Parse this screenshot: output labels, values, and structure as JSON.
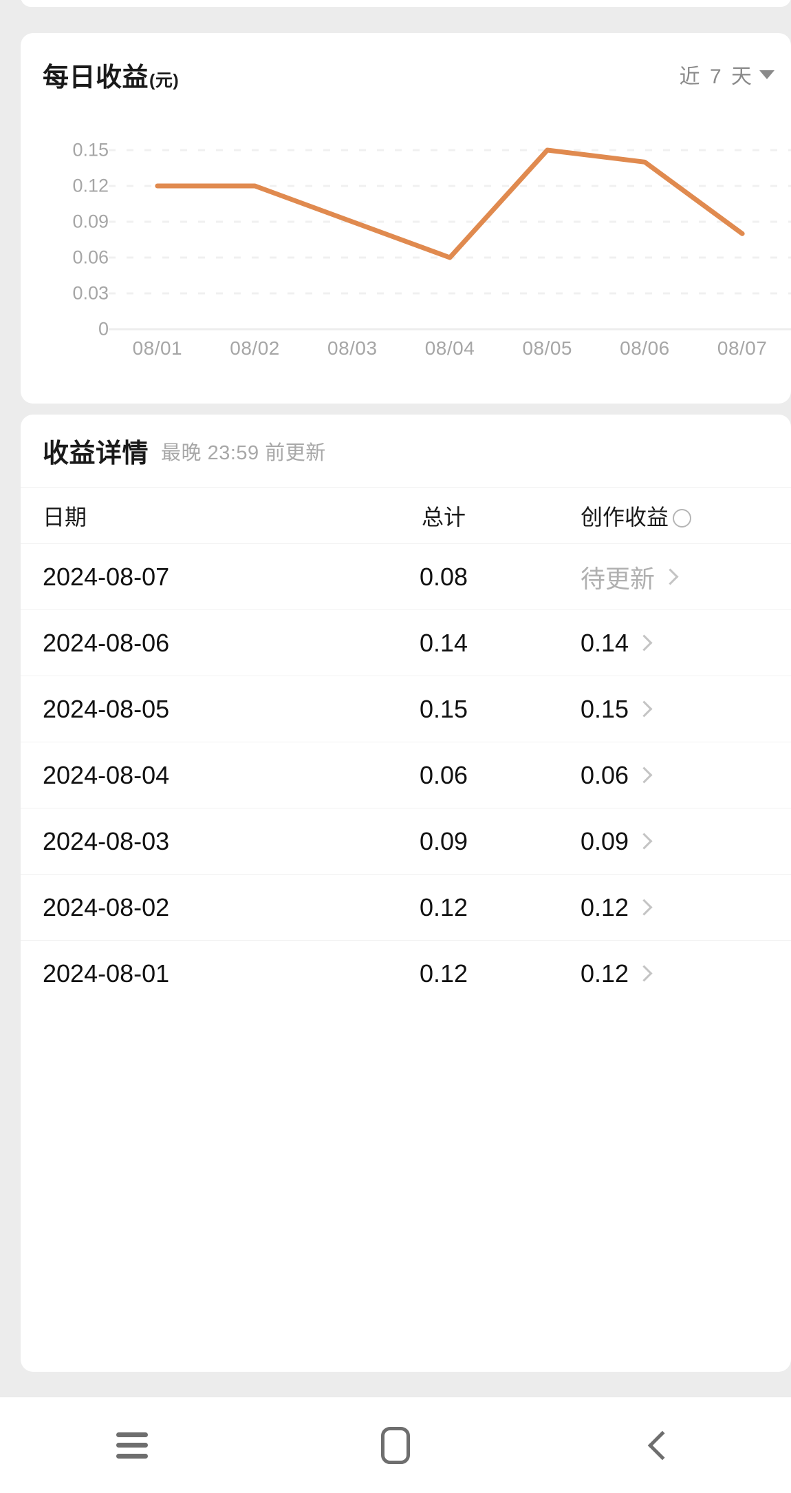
{
  "chart_card": {
    "title": "每日收益",
    "unit": "(元)",
    "range_label": "近 7 天",
    "caret_icon": "chevron-down-icon"
  },
  "detail_card": {
    "title": "收益详情",
    "subtitle": "最晚 23:59 前更新",
    "columns": {
      "date": "日期",
      "total": "总计",
      "creation": "创作收益"
    },
    "info_icon": "info-circle-icon",
    "rows": [
      {
        "date": "2024-08-07",
        "total": "0.08",
        "creation": "待更新",
        "pending": true
      },
      {
        "date": "2024-08-06",
        "total": "0.14",
        "creation": "0.14",
        "pending": false
      },
      {
        "date": "2024-08-05",
        "total": "0.15",
        "creation": "0.15",
        "pending": false
      },
      {
        "date": "2024-08-04",
        "total": "0.06",
        "creation": "0.06",
        "pending": false
      },
      {
        "date": "2024-08-03",
        "total": "0.09",
        "creation": "0.09",
        "pending": false
      },
      {
        "date": "2024-08-02",
        "total": "0.12",
        "creation": "0.12",
        "pending": false
      },
      {
        "date": "2024-08-01",
        "total": "0.12",
        "creation": "0.12",
        "pending": false
      }
    ]
  },
  "navbar": {
    "recents_icon": "recents-menu-icon",
    "home_icon": "home-square-icon",
    "back_icon": "back-chevron-icon"
  },
  "colors": {
    "line": "#e08a4f",
    "axis_text": "#a6a6a6",
    "card_bg": "#ffffff",
    "page_bg": "#ececec"
  },
  "chart_data": {
    "type": "line",
    "title": "每日收益(元)",
    "xlabel": "",
    "ylabel": "",
    "categories": [
      "08/01",
      "08/02",
      "08/03",
      "08/04",
      "08/05",
      "08/06",
      "08/07"
    ],
    "values": [
      0.12,
      0.12,
      0.09,
      0.06,
      0.15,
      0.14,
      0.08
    ],
    "ytick_labels": [
      "0.15",
      "0.12",
      "0.09",
      "0.06",
      "0.03",
      "0"
    ],
    "yticks": [
      0.15,
      0.12,
      0.09,
      0.06,
      0.03,
      0
    ],
    "ylim": [
      0,
      0.165
    ],
    "grid": true,
    "grid_style": "dashed",
    "legend": "none",
    "series": [
      {
        "name": "每日收益",
        "color": "#e08a4f",
        "values": [
          0.12,
          0.12,
          0.09,
          0.06,
          0.15,
          0.14,
          0.08
        ]
      }
    ]
  }
}
